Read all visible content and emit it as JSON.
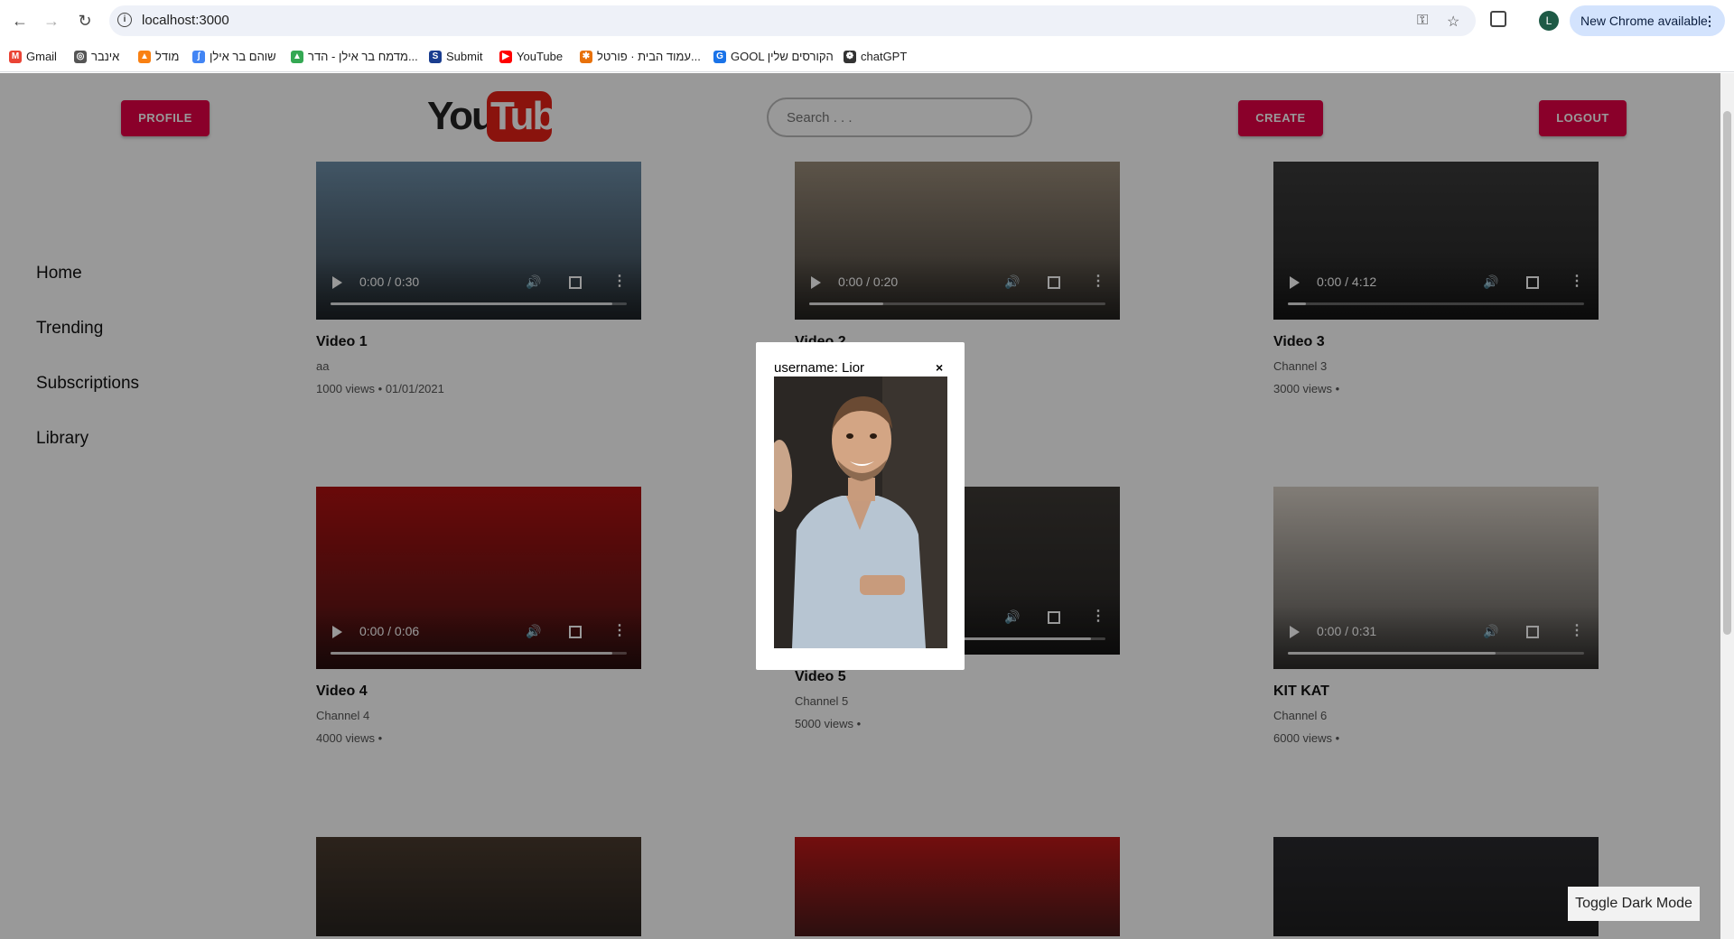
{
  "browser": {
    "url": "localhost:3000",
    "update_label": "New Chrome available",
    "profile_initial": "L",
    "bookmarks": [
      {
        "label": "Gmail",
        "icon": "gmail-icon",
        "color": "#ea4335",
        "glyph": "M"
      },
      {
        "label": "אינבר",
        "icon": "globe-icon",
        "color": "#555555",
        "glyph": "◎"
      },
      {
        "label": "מודל",
        "icon": "moodle-icon",
        "color": "#f98012",
        "glyph": "▲"
      },
      {
        "label": "שוהם בר אילן",
        "icon": "scribble-icon",
        "color": "#4285f4",
        "glyph": "ʃ"
      },
      {
        "label": "מדמח בר אילן - הדר...",
        "icon": "drive-icon",
        "color": "#34a853",
        "glyph": "▲"
      },
      {
        "label": "Submit",
        "icon": "submit-icon",
        "color": "#1a3d8f",
        "glyph": "S"
      },
      {
        "label": "YouTube",
        "icon": "youtube-icon",
        "color": "#ff0000",
        "glyph": "▶"
      },
      {
        "label": "עמוד הבית · פורטל...",
        "icon": "portal-icon",
        "color": "#e8710a",
        "glyph": "✱"
      },
      {
        "label": "GOOL הקורסים שלין",
        "icon": "gool-icon",
        "color": "#1a73e8",
        "glyph": "G"
      },
      {
        "label": "chatGPT",
        "icon": "chatgpt-icon",
        "color": "#333333",
        "glyph": "❁"
      }
    ]
  },
  "header": {
    "profile_label": "PROFILE",
    "create_label": "CREATE",
    "logout_label": "LOGOUT",
    "search_placeholder": "Search . . .",
    "logo_you": "You",
    "logo_tube": "Tube"
  },
  "sidebar": {
    "items": [
      {
        "label": "Home"
      },
      {
        "label": "Trending"
      },
      {
        "label": "Subscriptions"
      },
      {
        "label": "Library"
      }
    ]
  },
  "videos": [
    {
      "title": "Video 1",
      "channel": "aa",
      "meta": "1000 views • 01/01/2021",
      "time": "0:00 / 0:30",
      "progress": 0.95,
      "color": "#6e8fa9"
    },
    {
      "title": "Video 2",
      "channel": "",
      "meta": "",
      "time": "0:00 / 0:20",
      "progress": 0.25,
      "color": "#9a8c7a"
    },
    {
      "title": "Video 3",
      "channel": "Channel 3",
      "meta": "3000 views •",
      "time": "0:00 / 4:12",
      "progress": 0.06,
      "color": "#3a3a3a"
    },
    {
      "title": "Video 4",
      "channel": "Channel 4",
      "meta": "4000 views •",
      "time": "0:00 / 0:06",
      "progress": 0.95,
      "color": "#b01010"
    },
    {
      "title": "Video 5",
      "channel": "Channel 5",
      "meta": "5000 views •",
      "time": "",
      "progress": 0.95,
      "color": "#3d3935"
    },
    {
      "title": "KIT KAT",
      "channel": "Channel 6",
      "meta": "6000 views •",
      "time": "0:00 / 0:31",
      "progress": 0.7,
      "color": "#d8d0c6"
    },
    {
      "title": "",
      "channel": "",
      "meta": "",
      "time": "",
      "progress": 0,
      "color": "#4a3b2e"
    },
    {
      "title": "",
      "channel": "",
      "meta": "",
      "time": "",
      "progress": 0,
      "color": "#c01818"
    },
    {
      "title": "",
      "channel": "",
      "meta": "",
      "time": "",
      "progress": 0,
      "color": "#2a2a2e"
    }
  ],
  "modal": {
    "username_label": "username: Lior",
    "close_label": "×"
  },
  "toggle_label": "Toggle Dark Mode"
}
